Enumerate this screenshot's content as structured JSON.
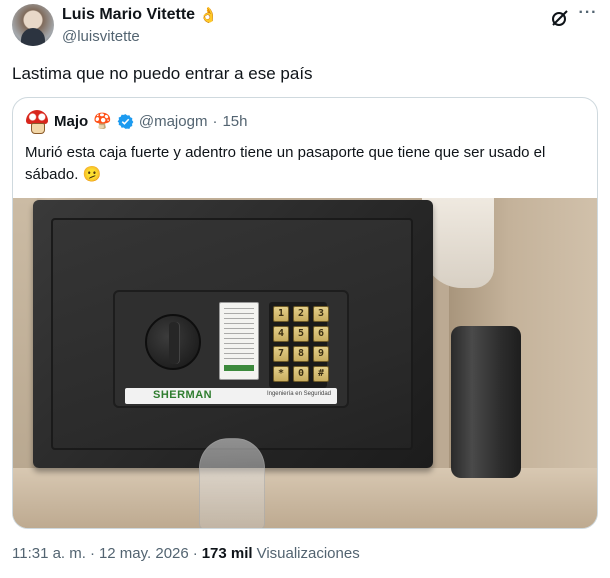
{
  "tweet": {
    "author": {
      "display_name": "Luis Mario Vitette",
      "name_emoji": "👌",
      "handle": "@luisvitette"
    },
    "text": "Lastima que no puedo entrar a ese país",
    "icons": [
      "grok-icon",
      "more-icon"
    ],
    "more_label": "···"
  },
  "quoted_tweet": {
    "display_name": "Majo",
    "name_emoji": "🍄",
    "verified": true,
    "handle": "@majogm",
    "separator": "·",
    "time": "15h",
    "text": "Murió esta caja fuerte y adentro tiene un pasaporte que tiene que ser usado el sábado. 🫤",
    "photo": {
      "keypad_keys": [
        "1",
        "2",
        "3",
        "4",
        "5",
        "6",
        "7",
        "8",
        "9",
        "*",
        "0",
        "#"
      ],
      "brand": "SHERMAN",
      "tagline": "Ingeniería en Seguridad"
    }
  },
  "meta": {
    "time": "11:31 a. m.",
    "separator1": "·",
    "date": "12 may. 2026",
    "separator2": "·",
    "views_count": "173 mil",
    "views_label": "Visualizaciones"
  },
  "colors": {
    "text_primary": "#0f1419",
    "text_secondary": "#536471",
    "border": "#cfd9de",
    "verified": "#1d9bf0"
  }
}
